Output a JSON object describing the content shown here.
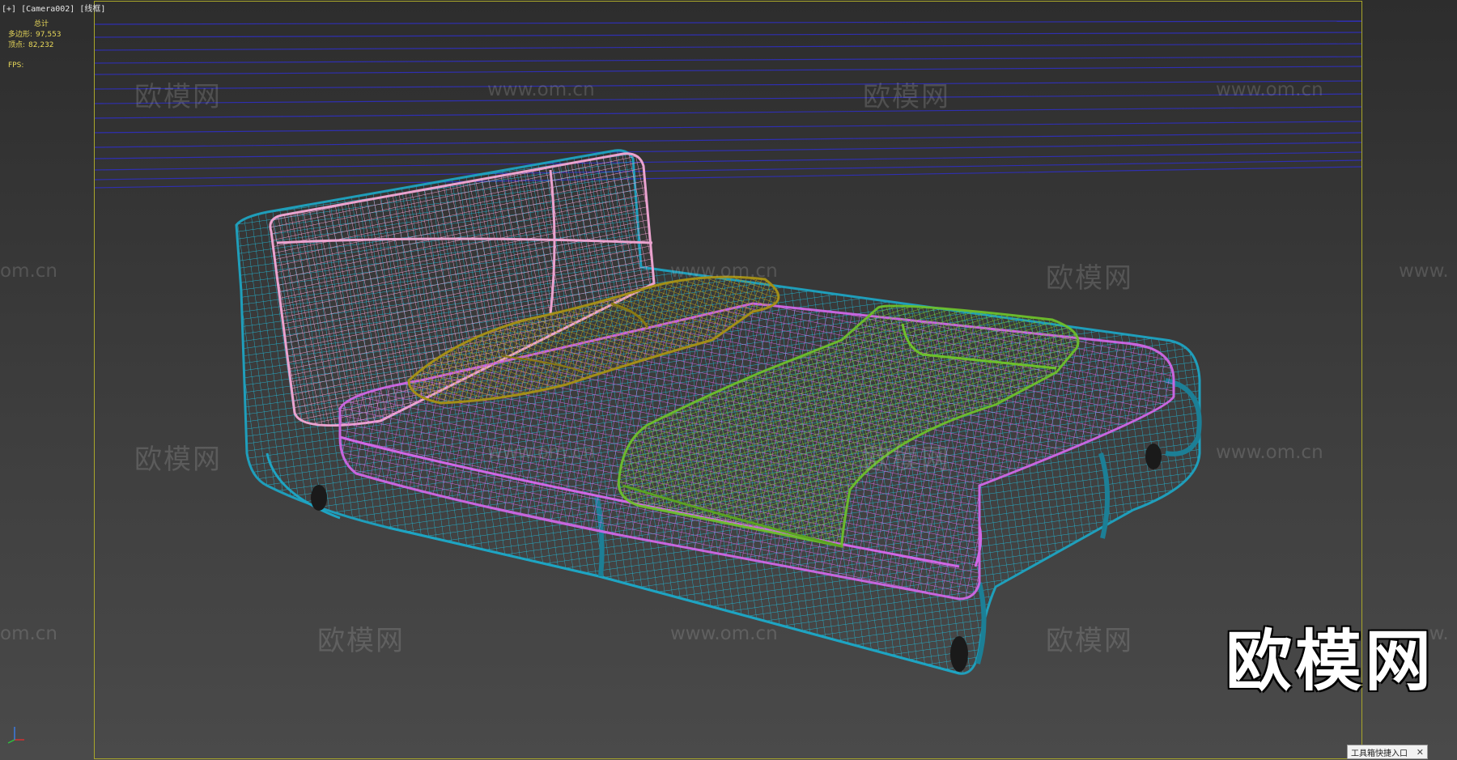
{
  "viewport": {
    "label": "[+] [Camera002] [线框]"
  },
  "stats": {
    "header": "总计",
    "polygons_label": "多边形:",
    "polygons_value": "97,553",
    "vertices_label": "顶点:",
    "vertices_value": "82,232",
    "fps_label": "FPS:"
  },
  "watermark": {
    "cn_text": "欧模网",
    "url_text": "www.om.cn",
    "partial_url_left": "om.cn",
    "partial_url_right": "www."
  },
  "logo": {
    "text": "欧模网"
  },
  "toolbox": {
    "label": "工具箱快捷入口",
    "close_icon": "close-icon"
  },
  "colors": {
    "frame_base": "#1fa7c4",
    "mattress": "#d46ce8",
    "headboard": "#e88fc8",
    "pillow": "#a89520",
    "throw": "#6fc22a",
    "horizon_lines": "#2f2fb0",
    "safe_frame": "#a9a62a",
    "stats_text": "#e8d85a"
  }
}
